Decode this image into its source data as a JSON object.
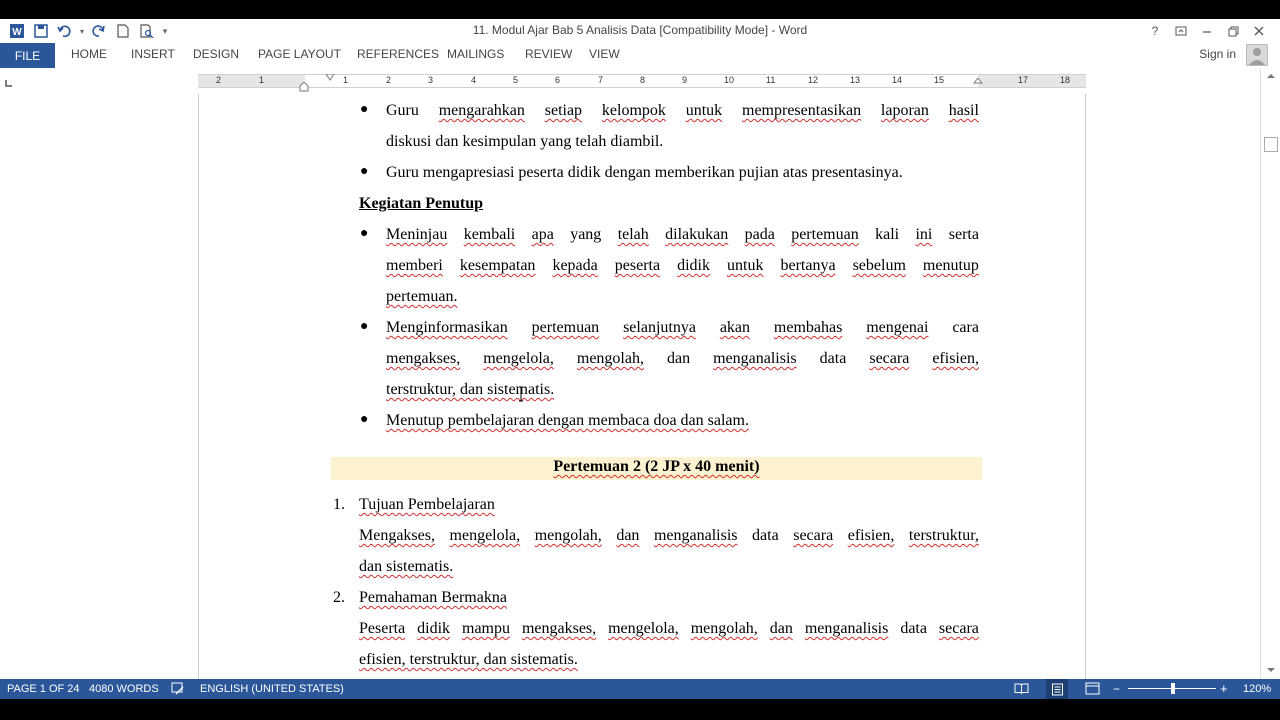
{
  "window": {
    "title": "11. Modul Ajar Bab 5 Analisis Data [Compatibility Mode] - Word",
    "help": "?",
    "signin": "Sign in"
  },
  "ribbon": {
    "tabs": [
      "FILE",
      "HOME",
      "INSERT",
      "DESIGN",
      "PAGE LAYOUT",
      "REFERENCES",
      "MAILINGS",
      "REVIEW",
      "VIEW"
    ]
  },
  "ruler": {
    "numbers": [
      "2",
      "1",
      "1",
      "2",
      "3",
      "4",
      "5",
      "6",
      "7",
      "8",
      "9",
      "10",
      "11",
      "12",
      "13",
      "14",
      "15",
      "17",
      "18"
    ]
  },
  "document": {
    "b1_l1": [
      "Guru",
      "mengarahkan",
      "setiap",
      "kelompok",
      "untuk",
      "mempresentasikan",
      "laporan",
      "hasil"
    ],
    "b1_l2": "diskusi dan kesimpulan yang telah diambil.",
    "b2": "Guru mengapresiasi peserta didik dengan memberikan pujian atas presentasinya.",
    "heading_penutup": "Kegiatan Penutup",
    "b3_l1": [
      "Meninjau",
      "kembali",
      "apa",
      "yang",
      "telah",
      "dilakukan",
      "pada",
      "pertemuan",
      "kali",
      "ini",
      "serta"
    ],
    "b3_l2": [
      "memberi",
      "kesempatan",
      "kepada",
      "peserta",
      "didik",
      "untuk",
      "bertanya",
      "sebelum",
      "menutup"
    ],
    "b3_l3": "pertemuan.",
    "b4_l1": [
      "Menginformasikan",
      "pertemuan",
      "selanjutnya",
      "akan",
      "membahas",
      "mengenai",
      "cara"
    ],
    "b4_l2": [
      "mengakses,",
      "mengelola,",
      "mengolah,",
      "dan",
      "menganalisis",
      "data",
      "secara",
      "efisien,"
    ],
    "b4_l3": "terstruktur, dan sistematis.",
    "b5": "Menutup pembelajaran dengan membaca doa dan salam.",
    "meeting2_title": "Pertemuan 2 (2 JP x 40 menit)",
    "n1_num": "1.",
    "n1_title": "Tujuan Pembelajaran",
    "n1_l1": [
      "Mengakses,",
      "mengelola,",
      "mengolah,",
      "dan",
      "menganalisis",
      "data",
      "secara",
      "efisien,",
      "terstruktur,"
    ],
    "n1_l2": "dan sistematis.",
    "n2_num": "2.",
    "n2_title": "Pemahaman Bermakna",
    "n2_l1": [
      "Peserta",
      "didik",
      "mampu",
      "mengakses,",
      "mengelola,",
      "mengolah,",
      "dan",
      "menganalisis",
      "data",
      "secara"
    ],
    "n2_l2": "efisien, terstruktur, dan sistematis."
  },
  "status": {
    "page": "PAGE 1 OF 24",
    "words": "4080 WORDS",
    "language": "ENGLISH (UNITED STATES)",
    "zoom": "120%"
  },
  "colors": {
    "accent": "#2b579a",
    "highlight": "#fdf2d0",
    "spellcheck": "#d32f2f"
  }
}
